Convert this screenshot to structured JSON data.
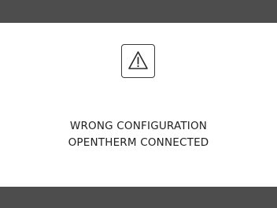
{
  "message": {
    "line1": "WRONG CONFIGURATION",
    "line2": "OPENTHERM CONNECTED"
  },
  "icons": {
    "warning": "warning-triangle-icon"
  },
  "colors": {
    "bar": "#4d4d4d",
    "background": "#ffffff",
    "text": "#1f1f1f"
  }
}
